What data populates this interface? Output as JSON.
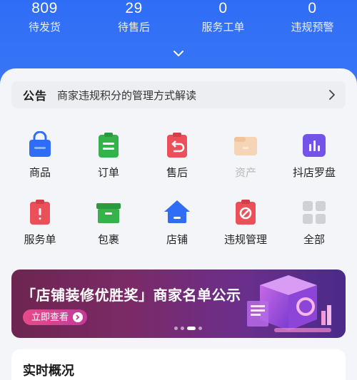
{
  "stats": [
    {
      "value": "809",
      "label": "待发货"
    },
    {
      "value": "29",
      "label": "待售后"
    },
    {
      "value": "0",
      "label": "服务工单"
    },
    {
      "value": "0",
      "label": "违规预警"
    }
  ],
  "notice": {
    "tag": "公告",
    "text": "商家违规积分的管理方式解读"
  },
  "grid": [
    {
      "label": "商品",
      "icon": "shopping-bag-icon"
    },
    {
      "label": "订单",
      "icon": "order-clipboard-icon"
    },
    {
      "label": "售后",
      "icon": "after-sales-icon"
    },
    {
      "label": "资产",
      "icon": "wallet-icon",
      "disabled": true
    },
    {
      "label": "抖店罗盘",
      "icon": "bar-chart-icon"
    },
    {
      "label": "服务单",
      "icon": "service-ticket-icon"
    },
    {
      "label": "包裹",
      "icon": "package-box-icon"
    },
    {
      "label": "店铺",
      "icon": "store-home-icon"
    },
    {
      "label": "违规管理",
      "icon": "violation-icon"
    },
    {
      "label": "全部",
      "icon": "all-apps-icon"
    }
  ],
  "banner": {
    "title": "「店铺装修优胜奖」商家名单公示",
    "button": "立即查看"
  },
  "realtime": {
    "title": "实时概况"
  },
  "colors": {
    "primary": "#2f6df6",
    "banner_bg": "#6e2550",
    "accent_pink": "#e84a8a"
  }
}
